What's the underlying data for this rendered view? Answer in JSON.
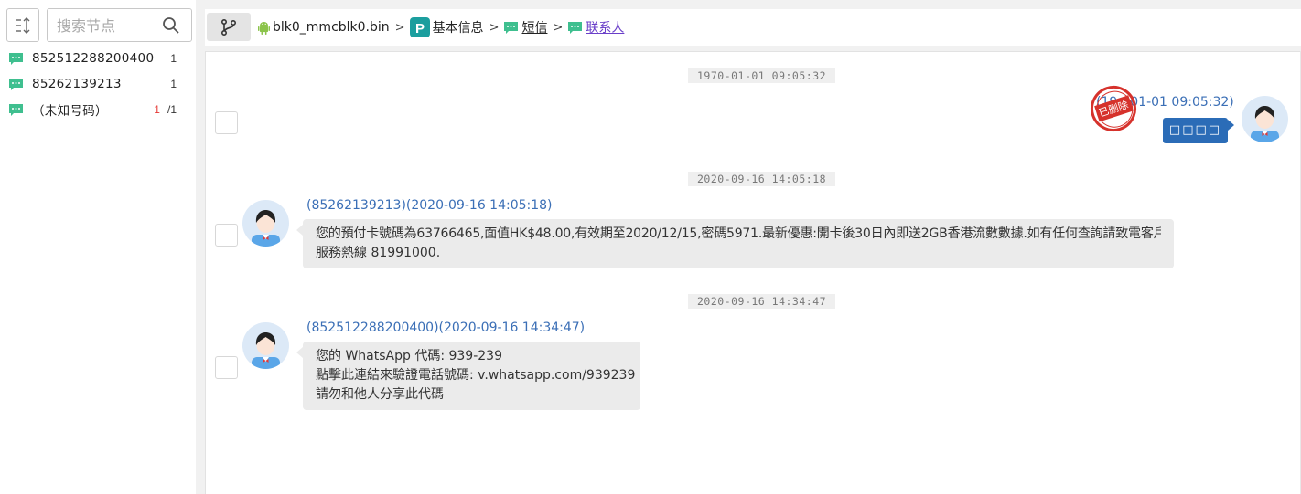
{
  "search": {
    "placeholder": "搜索节点"
  },
  "tree": {
    "items": [
      {
        "label": "852512288200400",
        "count": "1"
      },
      {
        "label": "85262139213",
        "count": "1"
      },
      {
        "label": "（未知号码）",
        "count_red": "1",
        "count": "/1"
      }
    ]
  },
  "breadcrumb": {
    "items": [
      {
        "label": "blk0_mmcblk0.bin",
        "icon": "android-icon"
      },
      {
        "label": "基本信息",
        "icon": "p-badge-icon"
      },
      {
        "label": "短信",
        "icon": "sms-icon"
      },
      {
        "label": "联系人",
        "icon": "sms-icon"
      }
    ],
    "separator": ">"
  },
  "messages": {
    "dates": [
      "1970-01-01 09:05:32",
      "2020-09-16 14:05:18",
      "2020-09-16 14:34:47"
    ],
    "outgoing": {
      "head": "(1970-01-01 09:05:32)",
      "head_visible": "01-01 09:05:32)",
      "head_prefix": "(19",
      "text": "□□□□",
      "stamp": "已删除"
    },
    "incoming": [
      {
        "head": "(85262139213)(2020-09-16 14:05:18)",
        "lines": [
          "您的預付卡號碼為63766465,面值HK$48.00,有效期至2020/12/15,密碼5971.最新優惠:開卡後30日內即送2GB香港流數數據.如有任何查詢請致電客戶",
          "服務熱線 81991000."
        ]
      },
      {
        "head": "(852512288200400)(2020-09-16 14:34:47)",
        "lines": [
          "您的 WhatsApp 代碼: 939-239",
          "點擊此連結來驗證電話號碼: v.whatsapp.com/939239",
          "請勿和他人分享此代碼"
        ]
      }
    ]
  },
  "colors": {
    "accent": "#2b6cb7",
    "link": "#3b6fb6",
    "stamp": "#d6322c",
    "sms_icon": "#3fbf8f"
  }
}
